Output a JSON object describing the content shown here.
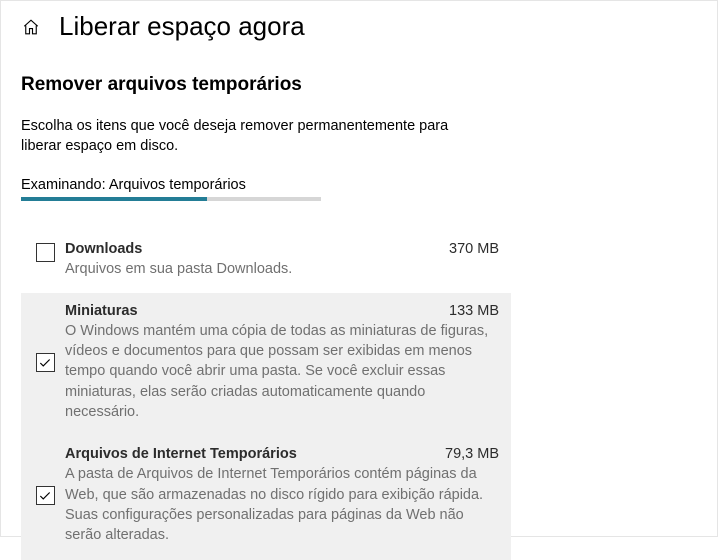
{
  "header": {
    "title": "Liberar espaço agora"
  },
  "section": {
    "title": "Remover arquivos temporários",
    "instruction": "Escolha os itens que você deseja remover permanentemente para liberar espaço em disco.",
    "status": "Examinando: Arquivos temporários",
    "progress_percent": 62
  },
  "items": [
    {
      "title": "Downloads",
      "size": "370 MB",
      "description": "Arquivos em sua pasta Downloads.",
      "checked": false,
      "highlighted": false
    },
    {
      "title": "Miniaturas",
      "size": "133 MB",
      "description": "O Windows mantém uma cópia de todas as miniaturas de figuras, vídeos e documentos para que possam ser exibidas em menos tempo quando você abrir uma pasta. Se você excluir essas miniaturas, elas serão criadas automaticamente quando necessário.",
      "checked": true,
      "highlighted": true
    },
    {
      "title": "Arquivos de Internet Temporários",
      "size": "79,3 MB",
      "description": "A pasta de Arquivos de Internet Temporários contém páginas da Web, que são armazenadas no disco rígido para exibição rápida. Suas configurações personalizadas para páginas da Web não serão alteradas.",
      "checked": true,
      "highlighted": true
    }
  ]
}
